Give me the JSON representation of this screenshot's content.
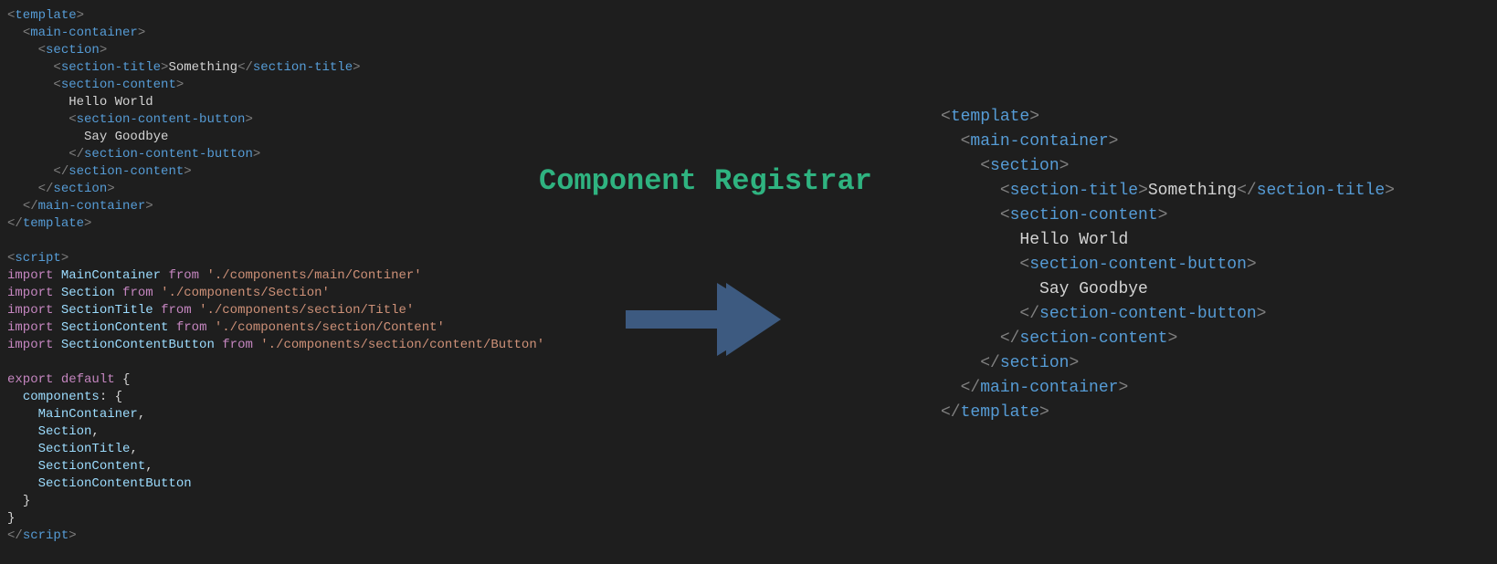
{
  "title": "Component Registrar",
  "colors": {
    "title": "#2fb380",
    "arrow": "#3d5a80",
    "tagName": "#569cd6",
    "tagPunc": "#808080",
    "keyword": "#c586c0",
    "identifier": "#9cdcfe",
    "string": "#ce9178",
    "text": "#d4d4d4",
    "bg": "#1e1e1e"
  },
  "leftCode": {
    "template": {
      "open": "template",
      "mainContainer": "main-container",
      "section": "section",
      "sectionTitle": "section-title",
      "sectionTitleText": "Something",
      "sectionContent": "section-content",
      "helloWorld": "Hello World",
      "sectionContentButton": "section-content-button",
      "sayGoodbye": "Say Goodbye"
    },
    "script": {
      "open": "script",
      "imports": [
        {
          "name": "MainContainer",
          "path": "'./components/main/Continer'"
        },
        {
          "name": "Section",
          "path": "'./components/Section'"
        },
        {
          "name": "SectionTitle",
          "path": "'./components/section/Title'"
        },
        {
          "name": "SectionContent",
          "path": "'./components/section/Content'"
        },
        {
          "name": "SectionContentButton",
          "path": "'./components/section/content/Button'"
        }
      ],
      "exportLine": "export default {",
      "componentsKey": "components:",
      "componentsList": [
        "MainContainer",
        "Section",
        "SectionTitle",
        "SectionContent",
        "SectionContentButton"
      ]
    }
  },
  "rightCode": {
    "template": {
      "open": "template",
      "mainContainer": "main-container",
      "section": "section",
      "sectionTitle": "section-title",
      "sectionTitleText": "Something",
      "sectionContent": "section-content",
      "helloWorld": "Hello World",
      "sectionContentButton": "section-content-button",
      "sayGoodbye": "Say Goodbye"
    }
  },
  "tokens": {
    "import": "import",
    "from": "from",
    "export": "export",
    "default": "default"
  }
}
